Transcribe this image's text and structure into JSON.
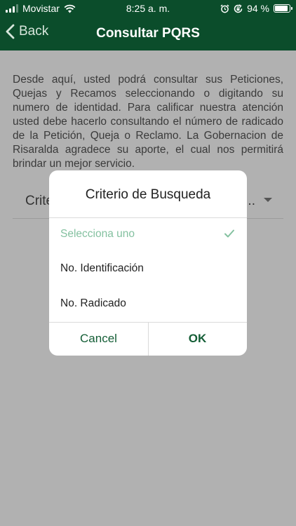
{
  "status_bar": {
    "carrier": "Movistar",
    "time": "8:25 a. m.",
    "battery": "94 %",
    "battery_level": 0.94
  },
  "nav": {
    "back_label": "Back",
    "title": "Consultar PQRS"
  },
  "content": {
    "description": "Desde aquí, usted podrá consultar sus Peticiones, Quejas y Recamos seleccionando o digitando su numero de identidad. Para calificar nuestra atención usted debe hacerlo consultando el número de radicado de la Petición, Queja o Reclamo. La Gobernacion de Risaralda agradece su aporte, el cual nos permitirá brindar un mejor servicio.",
    "select_label": "Crite",
    "select_value_ellipsis": "..."
  },
  "dialog": {
    "title": "Criterio de Busqueda",
    "options": [
      {
        "label": "Selecciona uno",
        "selected": true
      },
      {
        "label": "No. Identificación",
        "selected": false
      },
      {
        "label": "No. Radicado",
        "selected": false
      }
    ],
    "cancel_label": "Cancel",
    "ok_label": "OK"
  },
  "colors": {
    "header_bg": "#0b4d2b",
    "overlay_bg": "#b1b1b1",
    "accent": "#145e36",
    "selected_option": "#84c1a0"
  },
  "icons": [
    "signal-icon",
    "wifi-icon",
    "alarm-icon",
    "rotation-lock-icon",
    "battery-icon",
    "chevron-left-icon",
    "caret-down-icon",
    "check-icon"
  ]
}
